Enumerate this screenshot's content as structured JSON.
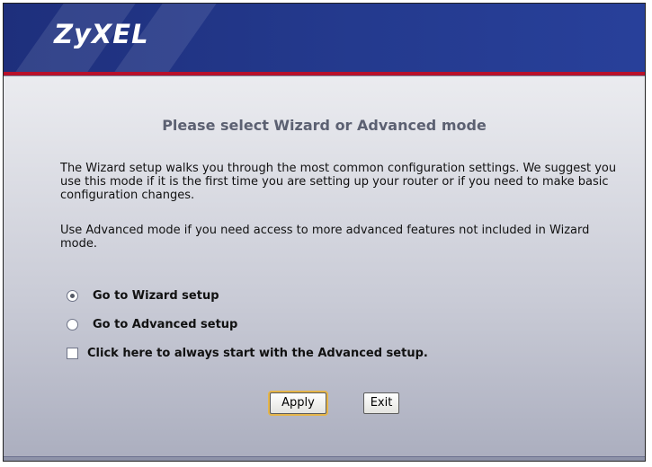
{
  "header": {
    "logo": "ZyXEL",
    "brand_colors": {
      "banner": "#243a8e",
      "accent_line": "#b8102a"
    }
  },
  "main": {
    "title": "Please select Wizard or Advanced mode",
    "description1": "The Wizard setup walks you through the most common configuration settings. We suggest you use this mode if it is the first time you are setting up your router or if you need to make basic configuration changes.",
    "description2": "Use Advanced mode if you need access to more advanced features not included in Wizard mode.",
    "options": {
      "wizard": {
        "label": "Go to Wizard setup",
        "selected": true
      },
      "advanced": {
        "label": "Go to Advanced setup",
        "selected": false
      }
    },
    "always_advanced": {
      "label": "Click here to always start with the Advanced setup.",
      "checked": false
    }
  },
  "buttons": {
    "apply": "Apply",
    "exit": "Exit"
  }
}
